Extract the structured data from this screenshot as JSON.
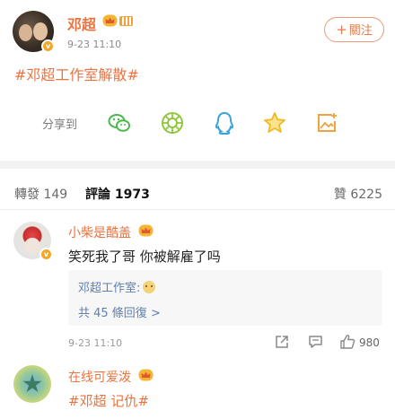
{
  "post": {
    "author": "邓超",
    "time": "9-23 11:10",
    "follow_label": "關注",
    "follow_plus": "+",
    "verified_mark": "v",
    "content": "#邓超工作室解散#"
  },
  "share": {
    "label": "分享到",
    "targets": [
      "wechat-icon",
      "moments-icon",
      "qq-icon",
      "qzone-icon",
      "save-image-icon"
    ]
  },
  "tabs": {
    "reposts": "轉發 149",
    "comments": "評論 1973",
    "likes": "贊 6225"
  },
  "comments": [
    {
      "author": "小柴是酷盖",
      "text": "笑死我了哥 你被解雇了吗",
      "reply_author": "邓超工作室:",
      "reply_more": "共 45 條回復 >",
      "time": "9-23 11:10",
      "likes": "980"
    },
    {
      "author": "在线可爱泼",
      "text": "#邓超 记仇#"
    }
  ],
  "colors": {
    "accent": "#eb7340",
    "link_blue": "#5e7fb0",
    "badge": "#f5a623"
  }
}
